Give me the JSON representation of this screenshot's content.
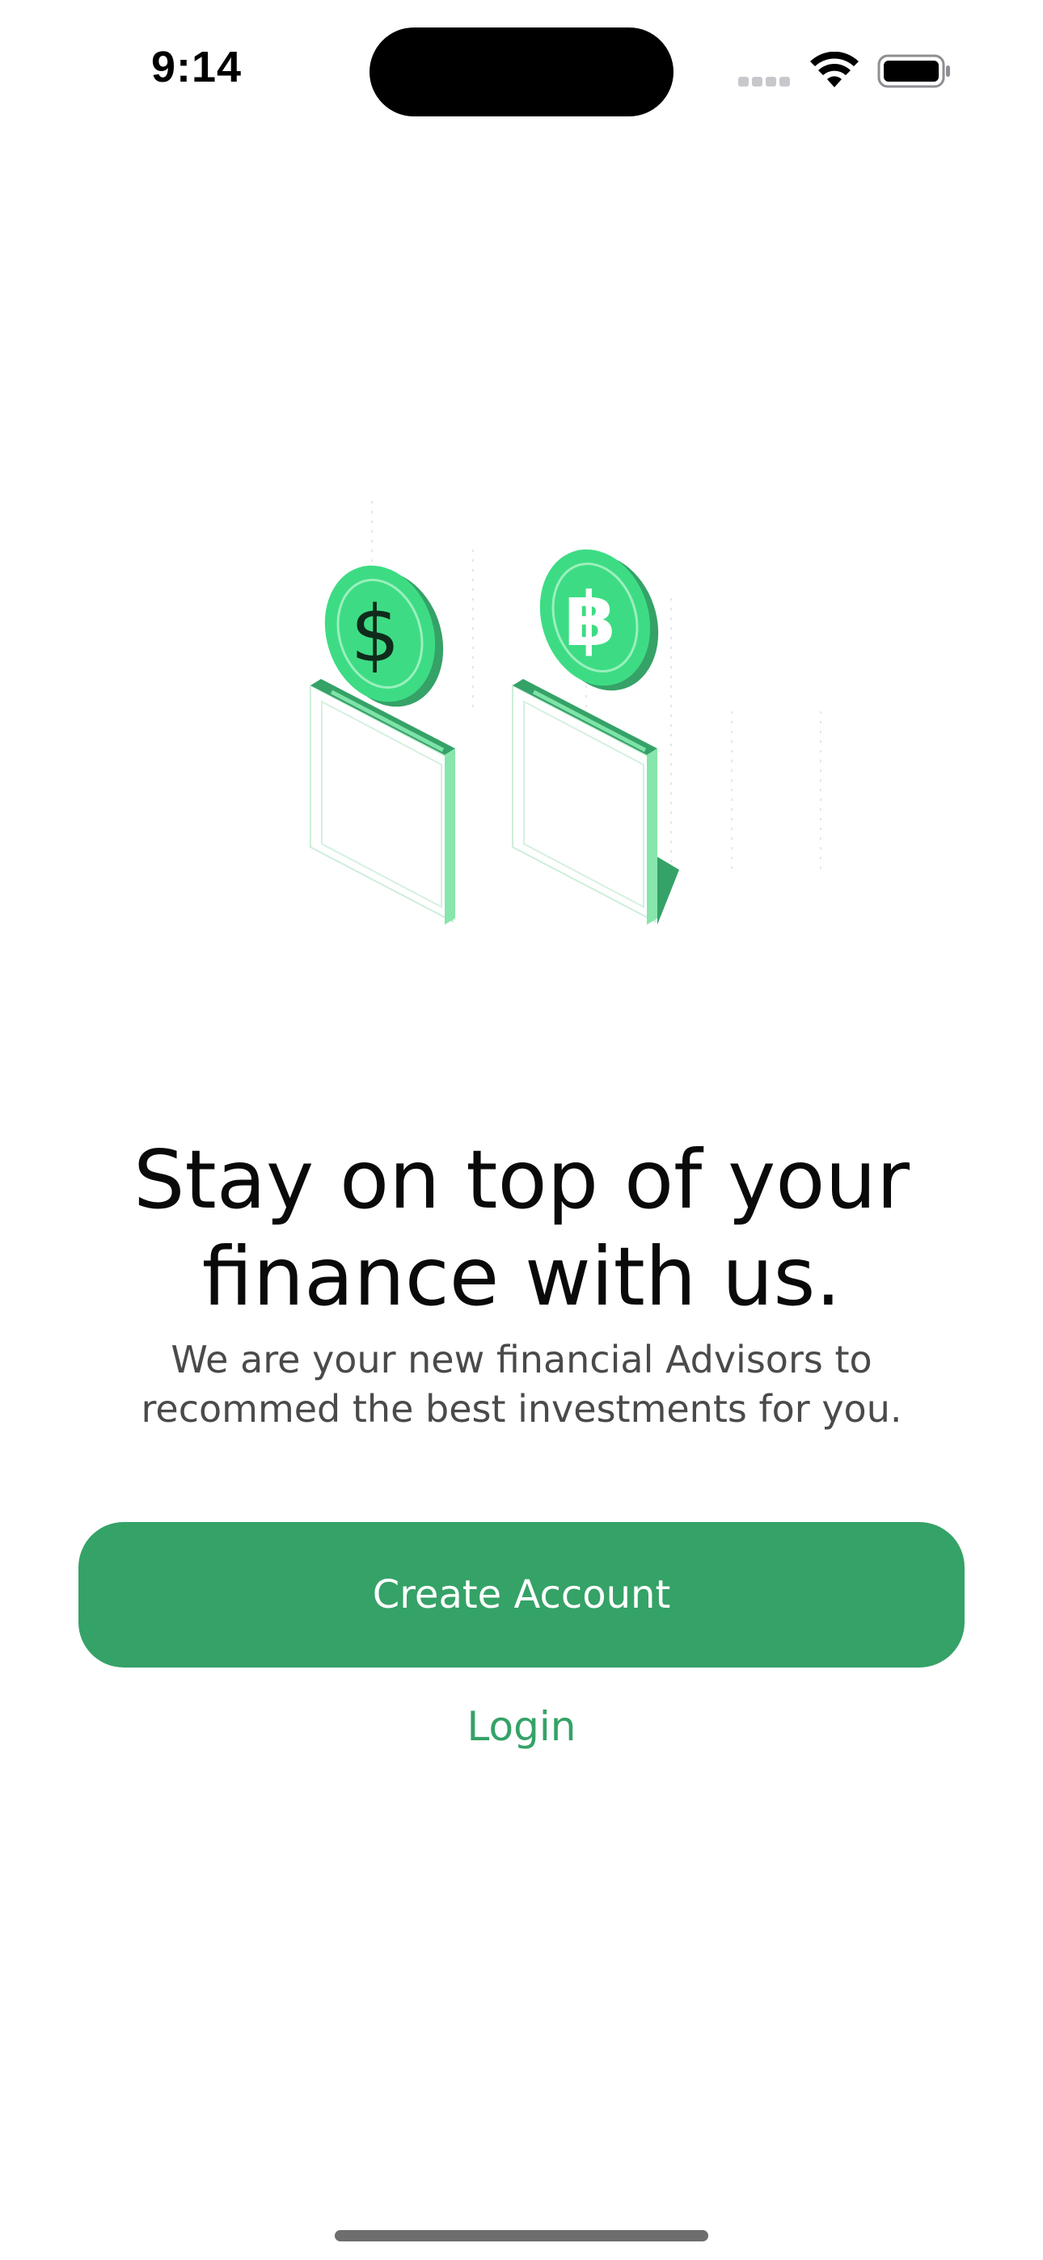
{
  "status_bar": {
    "time": "9:14"
  },
  "hero": {
    "coin_left_symbol": "$",
    "coin_left_icon": "dollar-coin-icon",
    "coin_right_icon": "bitcoin-coin-icon"
  },
  "main": {
    "title": "Stay on top of your finance with us.",
    "subtitle": "We are your new financial Advisors to recommed the best investments for you."
  },
  "actions": {
    "create_account_label": "Create Account",
    "login_label": "Login"
  },
  "colors": {
    "accent": "#35a267",
    "accent_light": "#3ddc84",
    "text": "#0a0a0a",
    "muted": "#4a4a4a"
  }
}
